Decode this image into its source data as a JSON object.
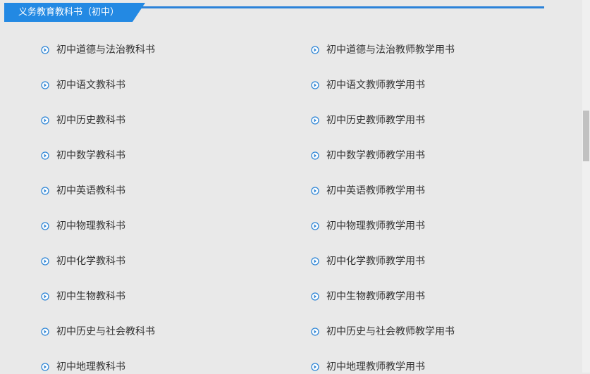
{
  "header": {
    "title": "义务教育教科书（初中）"
  },
  "items": {
    "left": [
      "初中道德与法治教科书",
      "初中语文教科书",
      "初中历史教科书",
      "初中数学教科书",
      "初中英语教科书",
      "初中物理教科书",
      "初中化学教科书",
      "初中生物教科书",
      "初中历史与社会教科书",
      "初中地理教科书"
    ],
    "right": [
      "初中道德与法治教师教学用书",
      "初中语文教师教学用书",
      "初中历史教师教学用书",
      "初中数学教师教学用书",
      "初中英语教师教学用书",
      "初中物理教师教学用书",
      "初中化学教师教学用书",
      "初中生物教师教学用书",
      "初中历史与社会教师教学用书",
      "初中地理教师教学用书"
    ]
  },
  "colors": {
    "accent": "#2389e3",
    "background": "#e9e9e9",
    "text": "#333333"
  },
  "icons": {
    "bullet": "circle-arrow-right-icon"
  }
}
